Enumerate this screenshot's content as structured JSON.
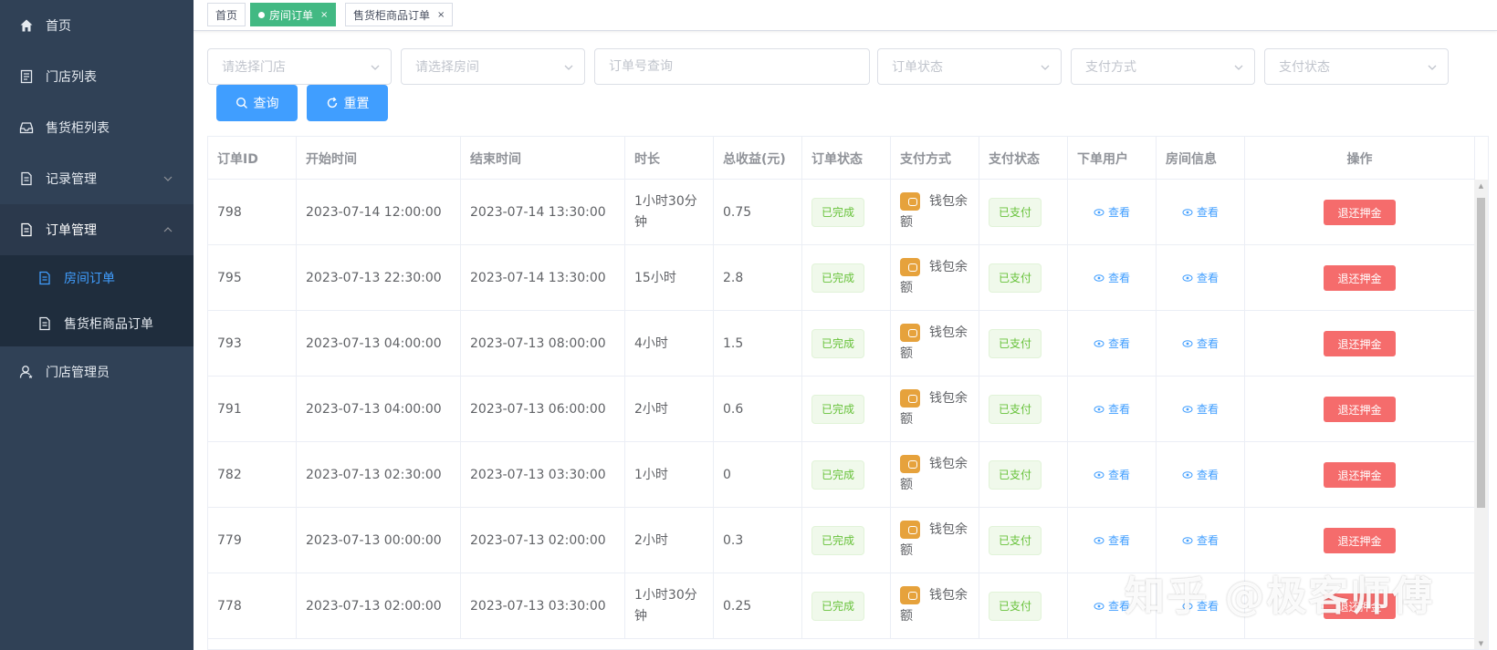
{
  "sidebar": {
    "items": [
      {
        "label": "首页",
        "icon": "home-icon"
      },
      {
        "label": "门店列表",
        "icon": "list-icon"
      },
      {
        "label": "售货柜列表",
        "icon": "inbox-icon"
      },
      {
        "label": "记录管理",
        "icon": "document-icon"
      },
      {
        "label": "订单管理",
        "icon": "document-icon"
      },
      {
        "label": "门店管理员",
        "icon": "user-icon"
      }
    ],
    "sub_items": [
      {
        "label": "房间订单",
        "icon": "document-icon"
      },
      {
        "label": "售货柜商品订单",
        "icon": "document-icon"
      }
    ]
  },
  "tags": [
    {
      "label": "首页"
    },
    {
      "label": "房间订单",
      "close": "×"
    },
    {
      "label": "售货柜商品订单",
      "close": "×"
    }
  ],
  "filters": {
    "store_placeholder": "请选择门店",
    "room_placeholder": "请选择房间",
    "order_no_placeholder": "订单号查询",
    "order_status_placeholder": "订单状态",
    "pay_method_placeholder": "支付方式",
    "pay_status_placeholder": "支付状态",
    "search_label": "查询",
    "reset_label": "重置"
  },
  "table": {
    "headers": [
      "订单ID",
      "开始时间",
      "结束时间",
      "时长",
      "总收益(元)",
      "订单状态",
      "支付方式",
      "支付状态",
      "下单用户",
      "房间信息",
      "操作"
    ],
    "view_label": "查看",
    "refund_label": "退还押金",
    "rows": [
      {
        "id": "798",
        "start": "2023-07-14 12:00:00",
        "end": "2023-07-14 13:30:00",
        "duration": "1小时30分钟",
        "revenue": "0.75",
        "status": "已完成",
        "pay_method": "钱包余额",
        "pay_status": "已支付"
      },
      {
        "id": "795",
        "start": "2023-07-13 22:30:00",
        "end": "2023-07-14 13:30:00",
        "duration": "15小时",
        "revenue": "2.8",
        "status": "已完成",
        "pay_method": "钱包余额",
        "pay_status": "已支付"
      },
      {
        "id": "793",
        "start": "2023-07-13 04:00:00",
        "end": "2023-07-13 08:00:00",
        "duration": "4小时",
        "revenue": "1.5",
        "status": "已完成",
        "pay_method": "钱包余额",
        "pay_status": "已支付"
      },
      {
        "id": "791",
        "start": "2023-07-13 04:00:00",
        "end": "2023-07-13 06:00:00",
        "duration": "2小时",
        "revenue": "0.6",
        "status": "已完成",
        "pay_method": "钱包余额",
        "pay_status": "已支付"
      },
      {
        "id": "782",
        "start": "2023-07-13 02:30:00",
        "end": "2023-07-13 03:30:00",
        "duration": "1小时",
        "revenue": "0",
        "status": "已完成",
        "pay_method": "钱包余额",
        "pay_status": "已支付"
      },
      {
        "id": "779",
        "start": "2023-07-13 00:00:00",
        "end": "2023-07-13 02:00:00",
        "duration": "2小时",
        "revenue": "0.3",
        "status": "已完成",
        "pay_method": "钱包余额",
        "pay_status": "已支付"
      },
      {
        "id": "778",
        "start": "2023-07-13 02:00:00",
        "end": "2023-07-13 03:30:00",
        "duration": "1小时30分钟",
        "revenue": "0.25",
        "status": "已完成",
        "pay_method": "钱包余额",
        "pay_status": "已支付"
      }
    ]
  },
  "watermark": "知乎 @极客师傅",
  "colors": {
    "sidebar_bg": "#304156",
    "submenu_bg": "#1f2d3d",
    "primary": "#409eff",
    "success": "#67c23a",
    "danger": "#f56c6c",
    "warning": "#e6a23c",
    "tag_active": "#42b983"
  }
}
